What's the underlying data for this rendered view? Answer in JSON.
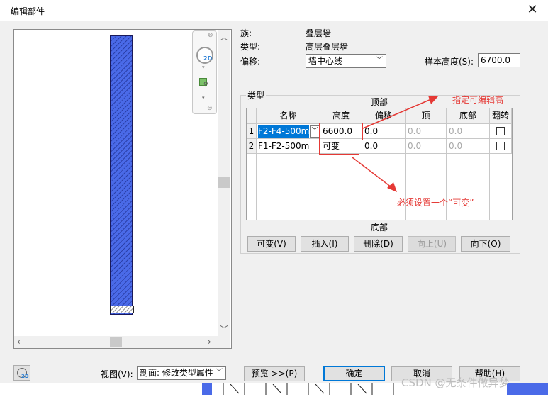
{
  "window": {
    "title": "编辑部件"
  },
  "properties": {
    "family_label": "族:",
    "family_value": "叠层墙",
    "type_label": "类型:",
    "type_value": "高层叠层墙",
    "offset_label": "偏移:",
    "offset_value": "墙中心线",
    "sample_height_label": "样本高度(S):",
    "sample_height_value": "6700.0"
  },
  "types_group": {
    "title": "类型",
    "top_label": "顶部",
    "bottom_label": "底部",
    "columns": [
      "名称",
      "高度",
      "偏移",
      "顶",
      "底部",
      "翻转"
    ],
    "rows": [
      {
        "num": "1",
        "name": "F2-F4-500mm",
        "height": "6600.0",
        "offset": "0.0",
        "top": "0.0",
        "bottom": "0.0",
        "flip": false
      },
      {
        "num": "2",
        "name": "F1-F2-500m",
        "height": "可变",
        "offset": "0.0",
        "top": "0.0",
        "bottom": "0.0",
        "flip": false
      }
    ],
    "buttons": {
      "variable": "可变(V)",
      "insert": "插入(I)",
      "delete": "删除(D)",
      "up": "向上(U)",
      "down": "向下(O)"
    }
  },
  "annotations": {
    "editable_height": "指定可编辑高",
    "must_variable": "必须设置一个“可变”"
  },
  "footer": {
    "view_label": "视图(V):",
    "view_value": "剖面: 修改类型属性",
    "preview_button": "预览 >>(P)",
    "ok_button": "确定",
    "cancel_button": "取消",
    "help_button": "帮助(H)"
  },
  "watermark": "CSDN @无条件做异梦",
  "colors": {
    "wall_fill": "#4a6ae8",
    "annotation_red": "#e53935",
    "selection_blue": "#0078d7"
  }
}
